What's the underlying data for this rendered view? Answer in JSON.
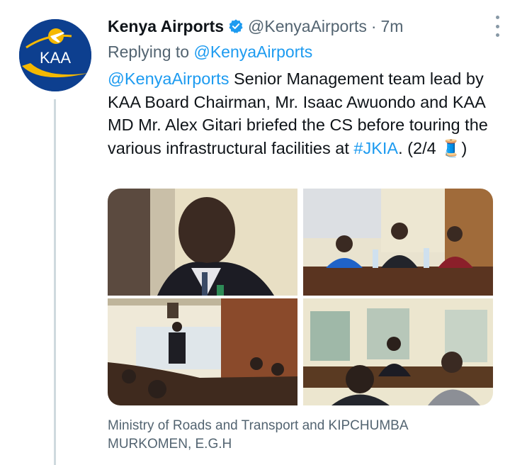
{
  "author": {
    "name": "Kenya Airports",
    "handle": "@KenyaAirports",
    "separator": "·",
    "time": "7m",
    "avatar_text": "KAA",
    "verified_icon": "verified-badge-icon"
  },
  "reply": {
    "prefix": "Replying to ",
    "to": "@KenyaAirports"
  },
  "tweet": {
    "mention": "@KenyaAirports",
    "body": " Senior Management team lead by KAA Board Chairman, Mr. Isaac Awuondo and KAA MD Mr. Alex Gitari briefed the CS before touring the various infrastructural facilities at ",
    "hashtag": "#JKIA",
    "tail": ". (2/4 ",
    "emoji": "🧵",
    "close": ")"
  },
  "media_caption": "Ministry of Roads and Transport and KIPCHUMBA MURKOMEN, E.G.H",
  "colors": {
    "link": "#1d9bf0",
    "secondary_text": "#536471",
    "thread_line": "#cfd9de",
    "avatar_blue": "#0d3f8f",
    "avatar_gold": "#f5b800"
  }
}
